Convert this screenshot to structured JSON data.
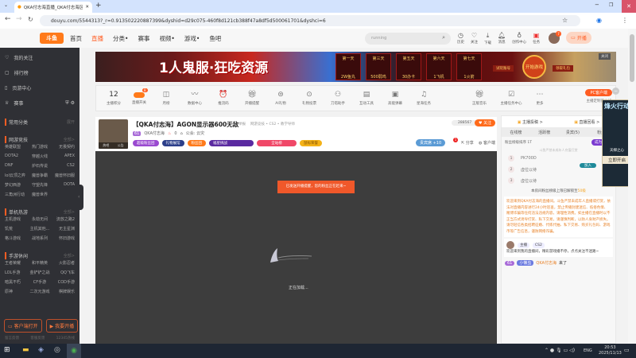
{
  "browser": {
    "tab_title": "QKA付志海直播_QKA付志海区",
    "url": "douyu.com/5544313?_r=0.913502220887399&dyshid=d29c075-460f8d121cb388f47a8df5d500061701&dyshci=6"
  },
  "header": {
    "logo": "斗鱼",
    "nav": [
      "首页",
      "直播",
      "分类•",
      "赛事",
      "视频•",
      "游戏•",
      "鱼吧"
    ],
    "search_value": "running",
    "icons": [
      "历史",
      "关注",
      "下载",
      "消息",
      "创作中心",
      "任务"
    ],
    "avatar_badge": "7",
    "live_button": "开播"
  },
  "sidebar": {
    "items": [
      "我的关注",
      "排行榜",
      "页游中心",
      "赛事"
    ],
    "sections": [
      {
        "title": "常用分类",
        "more": "展开",
        "items": []
      },
      {
        "title": "网游竞技",
        "more": "全部>",
        "items": [
          "英雄联盟",
          "热门游戏",
          "无畏契约",
          "DOTA2",
          "穿越火线",
          "APEX",
          "DNF",
          "炉石传说",
          "CS2",
          "lol云顶之弈",
          "魔兽争霸",
          "魔兽怀旧服",
          "梦幻西游",
          "守望先锋",
          "DOTA",
          "三角洲行动",
          "魔兽世界",
          ""
        ]
      },
      {
        "title": "单机热游",
        "more": "全部>",
        "items": [
          "主机游戏",
          "永劫无间",
          "流放之路2",
          "饥荒",
          "主机其他...",
          "无主星渊",
          "格斗游戏",
          "战地系列",
          "怀旧游戏"
        ]
      },
      {
        "title": "手游休闲",
        "more": "全部>",
        "items": [
          "王者荣耀",
          "和平精英",
          "火影忍者",
          "LOL手游",
          "金铲铲之战",
          "QQ飞车",
          "暗黑不朽",
          "CF手游",
          "COD手游",
          "原神",
          "二次元游戏",
          "棋牌娱乐"
        ]
      }
    ],
    "client_button": "客户端打开",
    "start_live_button": "我要开播",
    "footer": [
      "留言反馈",
      "客服反馈",
      "12345热线"
    ]
  },
  "banner": {
    "slogan": "1人鬼服·狂吃资源",
    "days": [
      {
        "day": "第一天",
        "reward": "2W鱼丸"
      },
      {
        "day": "第三天",
        "reward": "500弱鸡"
      },
      {
        "day": "第五天",
        "reward": "30办卡"
      },
      {
        "day": "第六天",
        "reward": "1飞机"
      },
      {
        "day": "第七天",
        "reward": "1火箭"
      }
    ],
    "left_btn": "试玩账号",
    "center_btn": "开始游戏",
    "right_btn": "领取礼包",
    "close": "关闭"
  },
  "toolbar": {
    "score": "12",
    "score_label": "主播积分",
    "toggle_badge": "8",
    "items": [
      "直播开关",
      "月榜",
      "数据中心",
      "推流码",
      "开播提醒",
      "AI礼物",
      "礼物投票",
      "刀塔助手",
      "互动工具",
      "高能弹幕",
      "星海任务",
      "正版音乐",
      "主播任务中心",
      "更多"
    ],
    "pc_client": "PC客户端",
    "pc_note": "主播定制已上线"
  },
  "room": {
    "title": "【QKA付志海】AGON显示器600无敌",
    "report": "举报",
    "category": "网游竞技 • CS2 • 教学导师",
    "level": "61",
    "streamer": "QKA付志海",
    "hot": "0",
    "notice": "公会: 云灾",
    "avatar_tags": [
      "热吧",
      "公告"
    ],
    "pills": [
      "超级粉丝团",
      "礼物展馆",
      "粉丝团",
      "福星挑战",
      "全站榜",
      "鼠标荣誉"
    ],
    "followers": "288567",
    "follow": "关注",
    "vip_label": "贵宾席",
    "vip_count": "+10",
    "vip_badge": "1",
    "share": "分享",
    "client": "客户端"
  },
  "video": {
    "toast": "已发送开播提醒，您的粉丝正在赶来~",
    "loading": "正在加载..."
  },
  "right_panel": {
    "top_links": [
      "主播投稿 >",
      "直播回看 >"
    ],
    "tabs": [
      "在线榜",
      "活跃榜",
      "贵宾(5)",
      "粉丝"
    ],
    "fan_rank_title": "粉丝榜级排序 1T",
    "power_label": "成为粉丝",
    "notice_small": "斗鱼严禁未成年人充值打赏",
    "ranks": [
      {
        "n": "1",
        "name": "PK700D"
      },
      {
        "n": "2",
        "name": "虚位以待"
      },
      {
        "n": "3",
        "name": "虚位以待"
      }
    ],
    "join_btn": "加入",
    "rank_note": "本房间粉丝榜级上限已解锁至",
    "rank_note_level": "50级",
    "system_msg": "欢迎来到QKA付志海的直播间。斗鱼严禁未成年人直播或打赏，依法对直播内容进行24小时巡查，禁止传播封建迷信、低俗色情、赌博诈骗等任何违法违规内容，请理性消费。如主播在直播时以不正当方式诱导打赏、私下交易，请谨慎判断，以防人身财产损失。请勿轻信各类招聘征婚、代练代抽、私下交易、购买礼包码、游戏币等广告信息，谨防网络诈骗。",
    "host_tag": "主播",
    "cs_tag": "CS2",
    "host_msg": "欢迎来到我的直播间，精彩游戏播不停，点点关注不迷路~",
    "enter_level": "61",
    "enter_badge": "小懒虫",
    "enter_name": "QKA付志海",
    "enter_text": "来了"
  },
  "float_ad": {
    "title": "烽火行动",
    "sub": "天梯之心",
    "cta": "立即开启"
  },
  "taskbar": {
    "lang": "ENG",
    "time": "20:53",
    "date": "2025/11/13"
  }
}
